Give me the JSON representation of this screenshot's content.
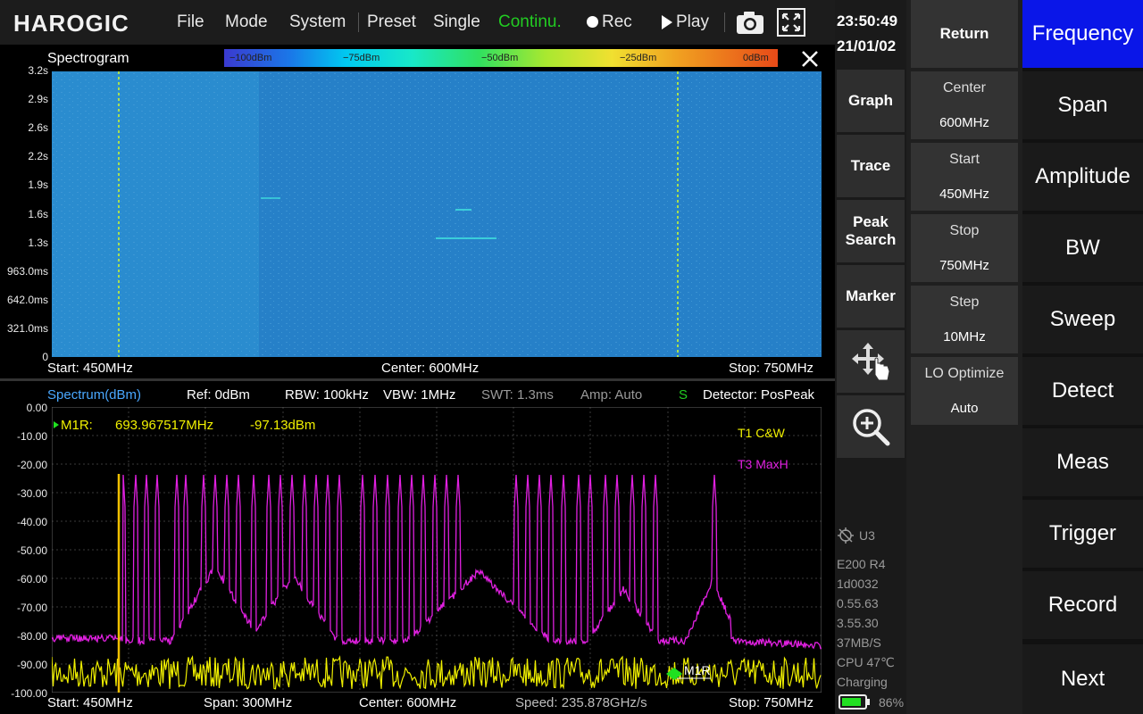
{
  "topbar": {
    "logo": "HAROGIC",
    "menu": {
      "file": "File",
      "mode": "Mode",
      "system": "System",
      "preset": "Preset",
      "single": "Single",
      "continuous": "Continu.",
      "rec": "Rec",
      "play": "Play"
    }
  },
  "spectrogram": {
    "title": "Spectrogram",
    "colorbar_labels": [
      "−100dBm",
      "−75dBm",
      "−50dBm",
      "−25dBm",
      "0dBm"
    ],
    "time_labels": [
      "3.2s",
      "2.9s",
      "2.6s",
      "2.2s",
      "1.9s",
      "1.6s",
      "1.3s",
      "963.0ms",
      "642.0ms",
      "321.0ms",
      "0"
    ],
    "start": "Start: 450MHz",
    "center": "Center: 600MHz",
    "stop": "Stop: 750MHz"
  },
  "spectrum": {
    "title": "Spectrum(dBm)",
    "ref": "Ref: 0dBm",
    "rbw": "RBW: 100kHz",
    "vbw": "VBW: 1MHz",
    "swt": "SWT: 1.3ms",
    "amp": "Amp: Auto",
    "s_flag": "S",
    "detector": "Detector: PosPeak",
    "db_labels": [
      "0.00",
      "-10.00",
      "-20.00",
      "-30.00",
      "-40.00",
      "-50.00",
      "-60.00",
      "-70.00",
      "-80.00",
      "-90.00",
      "-100.00"
    ],
    "marker_label": "M1R:",
    "marker_freq": "693.967517MHz",
    "marker_level": "-97.13dBm",
    "marker_tag": "M1R",
    "legend_t1": "T1  C&W",
    "legend_t3": "T3  MaxH",
    "color_t1": "#f0f000",
    "color_t3": "#e020e0"
  },
  "footer": {
    "start": "Start: 450MHz",
    "span": "Span: 300MHz",
    "center": "Center: 600MHz",
    "speed": "Speed: 235.878GHz/s",
    "stop": "Stop: 750MHz"
  },
  "status": {
    "time": "23:50:49",
    "date": "21/01/02",
    "gps": "U3",
    "device": "E200 R4",
    "serial": "1d0032",
    "ver1": "0.55.63",
    "ver2": "3.55.30",
    "rate": "37MB/S",
    "cpu": "CPU  47℃",
    "charging": "Charging",
    "battery": "86%",
    "battery_level": 0.86
  },
  "midbuttons": {
    "graph": "Graph",
    "trace": "Trace",
    "peak_search_1": "Peak",
    "peak_search_2": "Search",
    "marker": "Marker"
  },
  "params": {
    "return": "Return",
    "items": [
      {
        "label": "Center",
        "value": "600MHz"
      },
      {
        "label": "Start",
        "value": "450MHz"
      },
      {
        "label": "Stop",
        "value": "750MHz"
      },
      {
        "label": "Step",
        "value": "10MHz"
      },
      {
        "label": "LO Optimize",
        "value": "Auto"
      }
    ]
  },
  "functions": [
    "Frequency",
    "Span",
    "Amplitude",
    "BW",
    "Sweep",
    "Detect",
    "Meas",
    "Trigger",
    "Record",
    "Next"
  ]
}
